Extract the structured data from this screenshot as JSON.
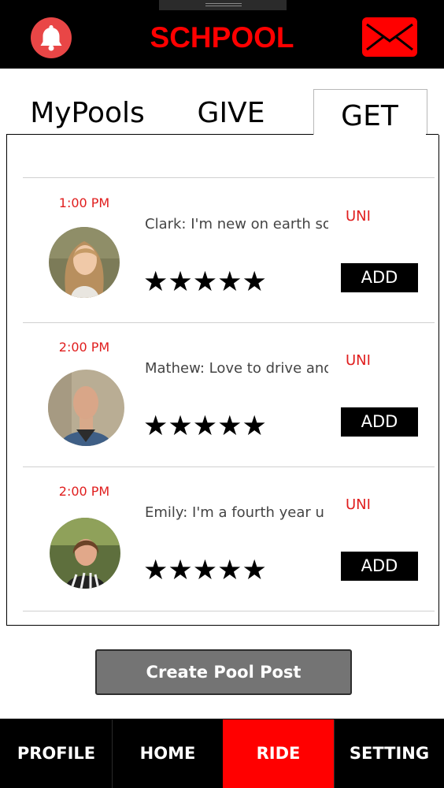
{
  "header": {
    "brand": "SCHPOOL",
    "icons": {
      "left": "bell-icon",
      "right": "mail-icon"
    },
    "colors": {
      "brand": "#ff0000",
      "bell": "#e94646",
      "mail": "#ff0000"
    }
  },
  "tabs": [
    {
      "label": "MyPools"
    },
    {
      "label": "GIVE"
    },
    {
      "label": "GET",
      "selected": true
    }
  ],
  "posts": [
    {
      "time": "1:00 PM",
      "text": "Clark: I'm new on earth so j",
      "tag": "UNI",
      "rating": "★★★★★",
      "action": "ADD"
    },
    {
      "time": "2:00 PM",
      "text": "Mathew: Love to drive and",
      "tag": "UNI",
      "rating": "★★★★★",
      "action": "ADD"
    },
    {
      "time": "2:00 PM",
      "text": "Emily: I'm a fourth year u of",
      "tag": "UNI",
      "rating": "★★★★★",
      "action": "ADD"
    }
  ],
  "create_button": {
    "label": "Create Pool Post"
  },
  "bottom_nav": [
    {
      "label": "PROFILE"
    },
    {
      "label": "HOME"
    },
    {
      "label": "RIDE",
      "active": true
    },
    {
      "label": "SETTING"
    }
  ],
  "accent_colors": {
    "active_nav": "#ff0000",
    "time_text": "#e01e1e"
  }
}
